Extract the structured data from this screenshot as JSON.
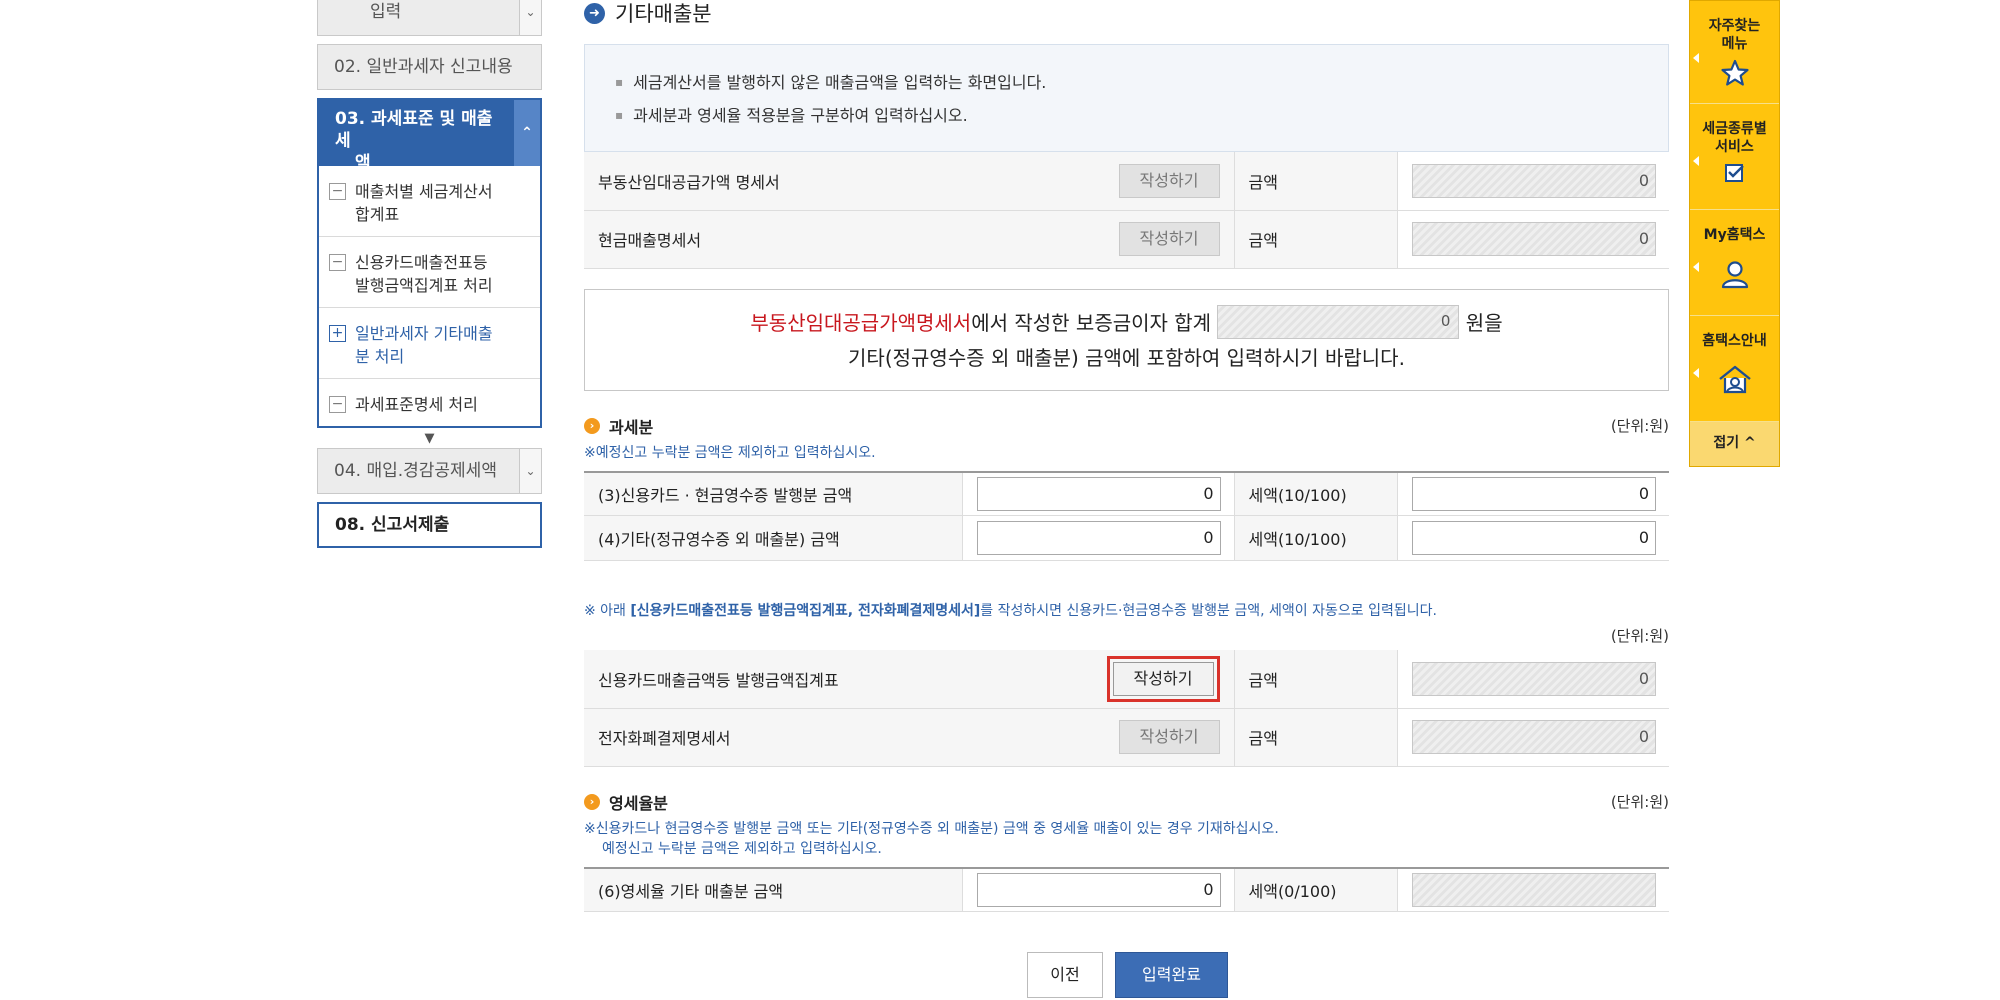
{
  "left_nav": {
    "top_partial": "입력",
    "step02": "02. 일반과세자 신고내용",
    "step03_l1": "03. 과세표준 및 매출세",
    "step03_l2": "액",
    "sub_items": [
      {
        "l1": "매출처별 세금계산서",
        "l2": "합계표",
        "sign": "−",
        "open": false
      },
      {
        "l1": "신용카드매출전표등",
        "l2": "발행금액집계표 처리",
        "sign": "−",
        "open": false
      },
      {
        "l1": "일반과세자 기타매출",
        "l2": "분 처리",
        "sign": "+",
        "open": true
      },
      {
        "l1": "과세표준명세 처리",
        "l2": "",
        "sign": "−",
        "open": false
      }
    ],
    "step04": "04. 매입.경감공제세액",
    "step08": "08. 신고서제출"
  },
  "main": {
    "title": "기타매출분",
    "info": [
      "세금계산서를 발행하지 않은 매출금액을 입력하는 화면입니다.",
      "과세분과 영세율 적용분을 구분하여 입력하십시오."
    ],
    "write_label": "작성하기",
    "amount_label": "금액",
    "top_rows": [
      {
        "label": "부동산임대공급가액 명세서",
        "value": "0"
      },
      {
        "label": "현금매출명세서",
        "value": "0"
      }
    ],
    "notice": {
      "red": "부동산임대공급가액명세서",
      "mid": "에서 작성한 보증금이자 합계",
      "value": "0",
      "end": "원을",
      "line2": "기타(정규영수증 외 매출분) 금액에 포함하여 입력하시기 바랍니다."
    },
    "taxable": {
      "title": "과세분",
      "unit": "(단위:원)",
      "note": "※예정신고 누락분 금액은 제외하고 입력하십시오.",
      "rows": [
        {
          "label": "(3)신용카드 · 현금영수증 발행분 금액",
          "value": "0",
          "tax_label": "세액(10/100)",
          "tax_value": "0"
        },
        {
          "label": "(4)기타(정규영수증 외 매출분) 금액",
          "value": "0",
          "tax_label": "세액(10/100)",
          "tax_value": "0"
        }
      ]
    },
    "auto_note": {
      "prefix": "※ 아래 ",
      "bold": "[신용카드매출전표등 발행금액집계표, 전자화폐결제명세서]",
      "suffix": "를 작성하시면 신용카드·현금영수증 발행분 금액, 세액이 자동으로 입력됩니다.",
      "unit": "(단위:원)"
    },
    "auto_rows": [
      {
        "label": "신용카드매출금액등 발행금액집계표",
        "value": "0",
        "enabled": true
      },
      {
        "label": "전자화폐결제명세서",
        "value": "0",
        "enabled": false
      }
    ],
    "zero_rate": {
      "title": "영세율분",
      "unit": "(단위:원)",
      "note1": "※신용카드나 현금영수증 발행분 금액 또는 기타(정규영수증 외 매출분) 금액 중 영세율 매출이 있는 경우 기재하십시오.",
      "note2": "예정신고 누락분 금액은 제외하고 입력하십시오.",
      "row": {
        "label": "(6)영세율 기타 매출분 금액",
        "value": "0",
        "tax_label": "세액(0/100)",
        "tax_value": ""
      }
    },
    "btn_prev": "이전",
    "btn_done": "입력완료"
  },
  "quick_menu": {
    "items": [
      {
        "l1": "자주찾는",
        "l2": "메뉴",
        "icon": "star-icon"
      },
      {
        "l1": "세금종류별",
        "l2": "서비스",
        "icon": "checkbox-icon"
      },
      {
        "l1": "My홈택스",
        "l2": "",
        "icon": "person-icon"
      },
      {
        "l1": "홈택스안내",
        "l2": "",
        "icon": "house-icon"
      }
    ],
    "fold": "접기",
    "colors": {
      "bg": "#ffc40d",
      "accent": "#2f62a8",
      "highlight": "#d9322b"
    }
  }
}
